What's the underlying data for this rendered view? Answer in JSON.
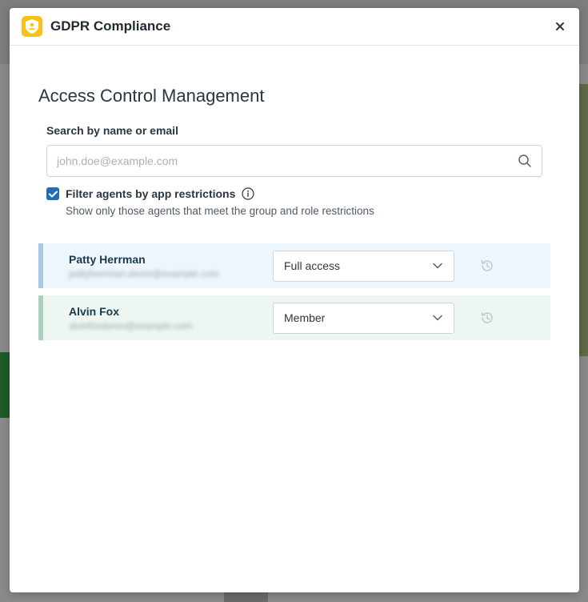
{
  "modal": {
    "title": "GDPR Compliance"
  },
  "main": {
    "heading": "Access Control Management",
    "search": {
      "label": "Search by name or email",
      "placeholder": "john.doe@example.com",
      "value": ""
    },
    "filter": {
      "checked": true,
      "label": "Filter agents by app restrictions",
      "hint": "Show only those agents that meet the group and role restrictions"
    }
  },
  "agents": [
    {
      "name": "Patty Herrman",
      "email": "pattyherrman.demo@example.com",
      "role": "Full access",
      "accent": "#a8c9e6",
      "row_bg": "#edf6fd"
    },
    {
      "name": "Alvin Fox",
      "email": "alvinfoxdemo@example.com",
      "role": "Member",
      "accent": "#a9cfbd",
      "row_bg": "#eef6f1"
    }
  ],
  "colors": {
    "brand_icon": "#f6c21a",
    "checkbox": "#1f6fb5"
  },
  "icons": {
    "app": "shield-user-icon",
    "close": "close-icon",
    "search": "search-icon",
    "info": "info-icon",
    "dropdown": "chevron-down-icon",
    "history": "history-icon"
  }
}
